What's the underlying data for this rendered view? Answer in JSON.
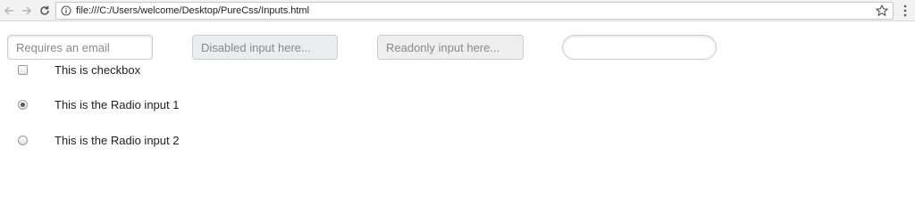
{
  "browser": {
    "url": "file:///C:/Users/welcome/Desktop/PureCss/Inputs.html",
    "icons": {
      "back": "back-arrow-icon",
      "forward": "forward-arrow-icon",
      "reload": "reload-icon",
      "info": "info-icon",
      "bookmark": "star-icon",
      "menu": "kebab-menu-icon"
    }
  },
  "form": {
    "email": {
      "value": "",
      "placeholder": "Requires an email"
    },
    "disabled": {
      "value": "",
      "placeholder": "Disabled input here..."
    },
    "readonly": {
      "value": "",
      "placeholder": "Readonly input here..."
    },
    "rounded": {
      "value": "",
      "placeholder": ""
    },
    "checkbox": {
      "label": "This is checkbox",
      "checked": false
    },
    "radio1": {
      "label": "This is the Radio input 1",
      "checked": true
    },
    "radio2": {
      "label": "This is the Radio input 2",
      "checked": false
    }
  }
}
